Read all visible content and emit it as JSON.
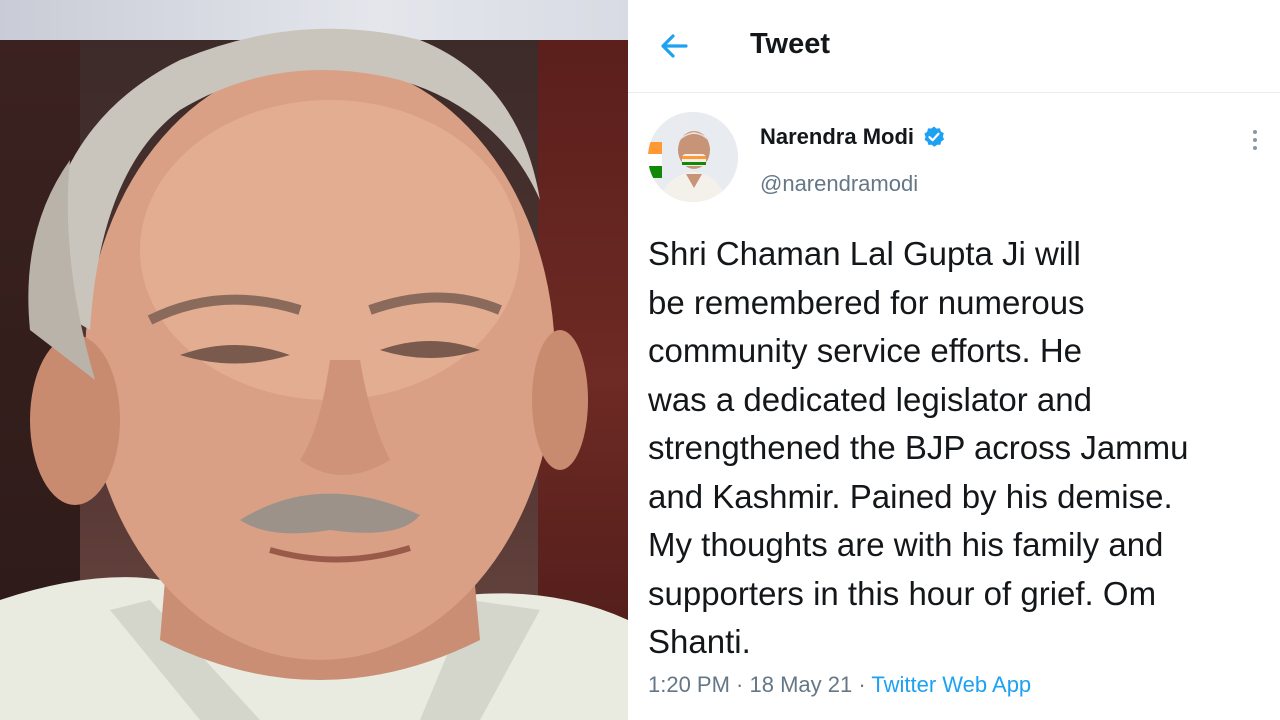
{
  "header": {
    "title": "Tweet"
  },
  "author": {
    "name": "Narendra Modi",
    "handle": "@narendramodi"
  },
  "tweet": {
    "lines": [
      "Shri Chaman Lal Gupta Ji will",
      "be remembered for numerous",
      "community service efforts. He",
      "was a dedicated legislator and",
      "strengthened the BJP across Jammu",
      "and Kashmir. Pained by his demise.",
      "My thoughts are with his family and",
      "supporters in this hour of grief. Om",
      "Shanti."
    ],
    "time": "1:20 PM",
    "separator": " · ",
    "date": "18 May 21",
    "app": "Twitter Web App"
  },
  "icons": {
    "back": "back-arrow-icon",
    "verified": "verified-badge-icon",
    "more": "more-vertical-icon"
  },
  "colors": {
    "accent": "#1da1f2",
    "text": "#14171a",
    "secondary": "#657786"
  }
}
